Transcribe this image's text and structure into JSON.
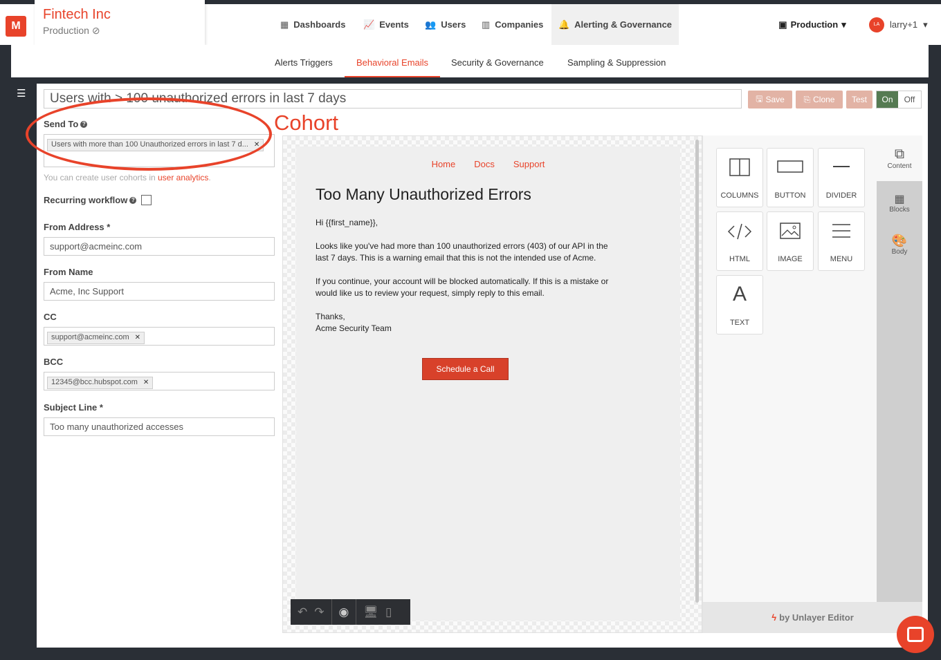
{
  "brand": {
    "logo": "M",
    "org_name": "Fintech Inc",
    "org_env": "Production",
    "accent": "#e8432a"
  },
  "nav": {
    "items": [
      {
        "label": "Dashboards",
        "icon": "grid-icon"
      },
      {
        "label": "Events",
        "icon": "bar-chart-icon"
      },
      {
        "label": "Users",
        "icon": "users-icon"
      },
      {
        "label": "Companies",
        "icon": "building-icon"
      },
      {
        "label": "Alerting & Governance",
        "icon": "bell-icon"
      }
    ],
    "env_selector": "Production",
    "user": {
      "initials": "LA",
      "name": "larry+1"
    }
  },
  "subnav": {
    "tabs": [
      "Alerts Triggers",
      "Behavioral Emails",
      "Security & Governance",
      "Sampling & Suppression"
    ],
    "active": "Behavioral Emails"
  },
  "workflow": {
    "title": "Users with > 100 unauthorized errors in last 7 days",
    "buttons": {
      "save": "Save",
      "clone": "Clone",
      "test": "Test",
      "on": "On",
      "off": "Off"
    }
  },
  "form": {
    "send_to_label": "Send To",
    "send_to_chip": "Users with more than 100 Unauthorized errors in last 7 d...",
    "hint_prefix": "You can create user cohorts in ",
    "hint_link": "user analytics",
    "hint_suffix": ".",
    "recurring_label": "Recurring workflow",
    "from_address_label": "From Address *",
    "from_address": "support@acmeinc.com",
    "from_name_label": "From Name",
    "from_name": "Acme, Inc Support",
    "cc_label": "CC",
    "cc_chip": "support@acmeinc.com",
    "bcc_label": "BCC",
    "bcc_chip": "12345@bcc.hubspot.com",
    "subject_label": "Subject Line *",
    "subject": "Too many unauthorized accesses"
  },
  "annotation": {
    "text": "Cohort"
  },
  "email": {
    "links": [
      "Home",
      "Docs",
      "Support"
    ],
    "title": "Too Many Unauthorized Errors",
    "greeting": "Hi {{first_name}},",
    "para1": "Looks like you've had more than 100 unauthorized errors (403) of our API in the last 7 days. This is a warning email that this is not the intended use of Acme.",
    "para2": "If you continue, your account will be blocked automatically. If this is a mistake or would like us to review your request, simply reply to this email.",
    "signoff1": "Thanks,",
    "signoff2": "Acme Security Team",
    "cta": "Schedule a Call"
  },
  "tools": {
    "blocks": [
      "COLUMNS",
      "BUTTON",
      "DIVIDER",
      "HTML",
      "IMAGE",
      "MENU",
      "TEXT"
    ],
    "side_tabs": [
      "Content",
      "Blocks",
      "Body"
    ],
    "footer": "by Unlayer Editor"
  }
}
